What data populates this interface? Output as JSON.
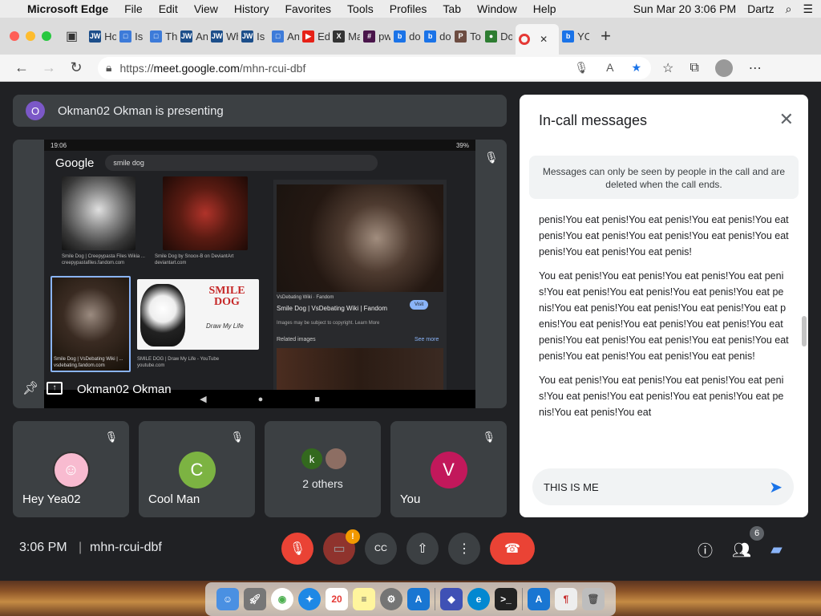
{
  "menubar": {
    "app": "Microsoft Edge",
    "items": [
      "File",
      "Edit",
      "View",
      "History",
      "Favorites",
      "Tools",
      "Profiles",
      "Tab",
      "Window",
      "Help"
    ],
    "clock": "Sun Mar 20  3:06 PM",
    "user": "Dartz"
  },
  "tabs": [
    {
      "label": "Ho",
      "icon": "JW",
      "color": "#1c4e8a"
    },
    {
      "label": "Is",
      "icon": "□",
      "color": "#3d7bd9"
    },
    {
      "label": "Th",
      "icon": "□",
      "color": "#3d7bd9"
    },
    {
      "label": "An",
      "icon": "JW",
      "color": "#1c4e8a"
    },
    {
      "label": "Wh",
      "icon": "JW",
      "color": "#1c4e8a"
    },
    {
      "label": "Is",
      "icon": "JW",
      "color": "#1c4e8a"
    },
    {
      "label": "An",
      "icon": "□",
      "color": "#3d7bd9"
    },
    {
      "label": "Ed",
      "icon": "▶",
      "color": "#e62117"
    },
    {
      "label": "Ma",
      "icon": "X",
      "color": "#333333"
    },
    {
      "label": "pw",
      "icon": "#",
      "color": "#4a154b"
    },
    {
      "label": "do",
      "icon": "b",
      "color": "#1a73e8"
    },
    {
      "label": "do",
      "icon": "b",
      "color": "#1a73e8"
    },
    {
      "label": "To",
      "icon": "P",
      "color": "#6d4c41"
    },
    {
      "label": "Do",
      "icon": "●",
      "color": "#2e7d32"
    },
    {
      "label": "YO",
      "icon": "b",
      "color": "#1a73e8"
    }
  ],
  "address": {
    "prefix": "https://",
    "domain": "meet.google.com",
    "path": "/mhn-rcui-dbf"
  },
  "meet": {
    "presenter_initial": "O",
    "presenter_banner": "Okman02 Okman is presenting",
    "presenter_name": "Okman02 Okman",
    "share": {
      "status_time": "19:06",
      "status_battery": "39%",
      "logo": "Google",
      "query": "smile dog",
      "thumb1_caption": "Smile Dog | Creepypasta Files Wikia ...",
      "thumb1_source": "creepypastafiles.fandom.com",
      "thumb2_caption": "Smile Dog by Snoox-B on DeviantArt",
      "thumb2_source": "deviantart.com",
      "thumb3_caption": "Smile Dog | VsDebating Wiki | ...",
      "thumb3_source": "vsdebating.fandom.com",
      "thumb4_caption": "SMILE DOG | Draw My Life - YouTube",
      "thumb4_source": "youtube.com",
      "thumb4_title": "SMILE DOG",
      "thumb4_sub": "Draw My Life",
      "panel_site": "VsDebating Wiki · Fandom",
      "panel_title": "Smile Dog | VsDebating Wiki | Fandom",
      "panel_visit": "Visit",
      "panel_copyright": "Images may be subject to copyright. Learn More",
      "panel_related": "Related images",
      "panel_seemore": "See more"
    },
    "tiles": [
      {
        "name": "Hey Yea02",
        "initial": "",
        "color": "#c2185b"
      },
      {
        "name": "Cool Man",
        "initial": "C",
        "color": "#7cb342"
      },
      {
        "name": "",
        "initial": "k",
        "color": "#33691e",
        "others": "2 others"
      },
      {
        "name": "You",
        "initial": "V",
        "color": "#c2185b"
      }
    ]
  },
  "chat": {
    "title": "In-call messages",
    "notice": "Messages can only be seen by people in the call and are deleted when the call ends.",
    "messages": [
      "penis!You eat penis!You eat penis!You eat penis!You eat penis!You eat penis!You eat penis!You eat penis!You eat penis!You eat penis!You eat penis!",
      "You eat penis!You eat penis!You eat penis!You eat penis!You eat penis!You eat penis!You eat penis!You eat penis!You eat penis!You eat penis!You eat penis!You eat penis!You eat penis!You eat penis!You eat penis!You eat penis!You eat penis!You eat penis!You eat penis!You eat penis!You eat penis!You eat penis!You eat penis!",
      "You eat penis!You eat penis!You eat penis!You eat penis!You eat penis!You eat penis!You eat penis!You eat penis!You eat penis!You eat"
    ],
    "input_value": "THIS IS ME"
  },
  "controls": {
    "time": "3:06 PM",
    "separator": "|",
    "code": "mhn-rcui-dbf",
    "participants_badge": "6",
    "camera_warning": "!"
  },
  "colors": {
    "meet_bg": "#202124",
    "tile_bg": "#3c4043",
    "end_call": "#ea4335",
    "accent": "#1a73e8"
  }
}
